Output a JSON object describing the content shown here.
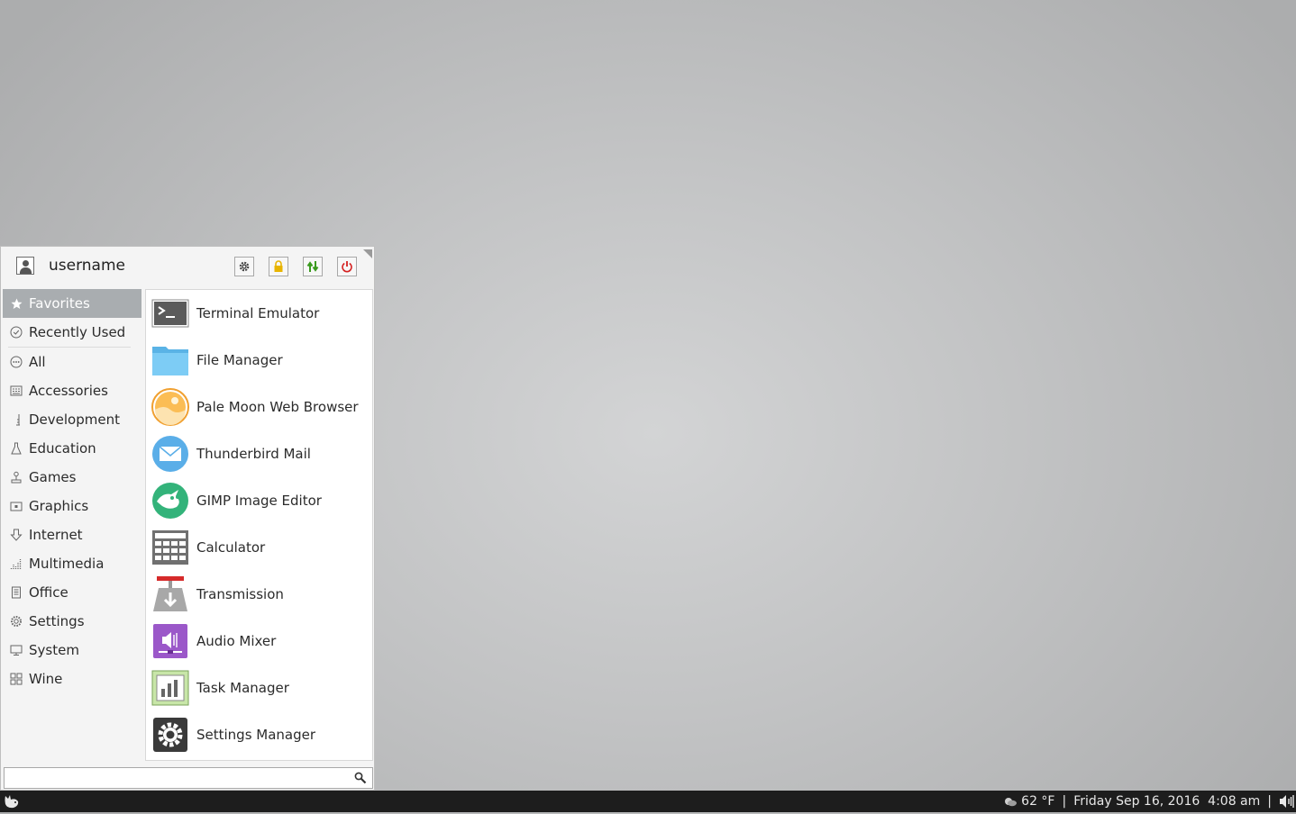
{
  "menu": {
    "username": "username",
    "actions": {
      "settings_icon": "gear-icon",
      "lock_icon": "lock-icon",
      "switch_user_icon": "switch-user-icon",
      "logout_icon": "power-icon"
    },
    "categories": [
      {
        "label": "Favorites",
        "icon": "star-icon",
        "active": true
      },
      {
        "label": "Recently Used",
        "icon": "clock-icon"
      },
      {
        "label": "All",
        "icon": "all-icon"
      },
      {
        "label": "Accessories",
        "icon": "accessories-icon"
      },
      {
        "label": "Development",
        "icon": "development-icon"
      },
      {
        "label": "Education",
        "icon": "flask-icon"
      },
      {
        "label": "Games",
        "icon": "joystick-icon"
      },
      {
        "label": "Graphics",
        "icon": "graphics-icon"
      },
      {
        "label": "Internet",
        "icon": "internet-icon"
      },
      {
        "label": "Multimedia",
        "icon": "multimedia-icon"
      },
      {
        "label": "Office",
        "icon": "document-icon"
      },
      {
        "label": "Settings",
        "icon": "gear-icon"
      },
      {
        "label": "System",
        "icon": "monitor-icon"
      },
      {
        "label": "Wine",
        "icon": "grid-icon"
      }
    ],
    "apps": [
      {
        "label": "Terminal Emulator",
        "icon": "terminal-icon"
      },
      {
        "label": "File Manager",
        "icon": "folder-icon"
      },
      {
        "label": "Pale Moon Web Browser",
        "icon": "pale-moon-icon"
      },
      {
        "label": "Thunderbird Mail",
        "icon": "mail-icon"
      },
      {
        "label": "GIMP Image Editor",
        "icon": "gimp-icon"
      },
      {
        "label": "Calculator",
        "icon": "calculator-icon"
      },
      {
        "label": "Transmission",
        "icon": "transmission-icon"
      },
      {
        "label": "Audio Mixer",
        "icon": "audio-mixer-icon"
      },
      {
        "label": "Task Manager",
        "icon": "task-manager-icon"
      },
      {
        "label": "Settings Manager",
        "icon": "settings-manager-icon"
      }
    ],
    "search": {
      "value": "",
      "placeholder": ""
    }
  },
  "panel": {
    "weather": "62 °F",
    "separator": "|",
    "datetime": "Friday Sep 16, 2016  4:08 am"
  },
  "colors": {
    "panel_bg": "#1d1d1d",
    "active_category": "#a9adb0",
    "lock_accent": "#e8b400",
    "switch_accent": "#3a9a1e",
    "power_accent": "#d42020"
  }
}
